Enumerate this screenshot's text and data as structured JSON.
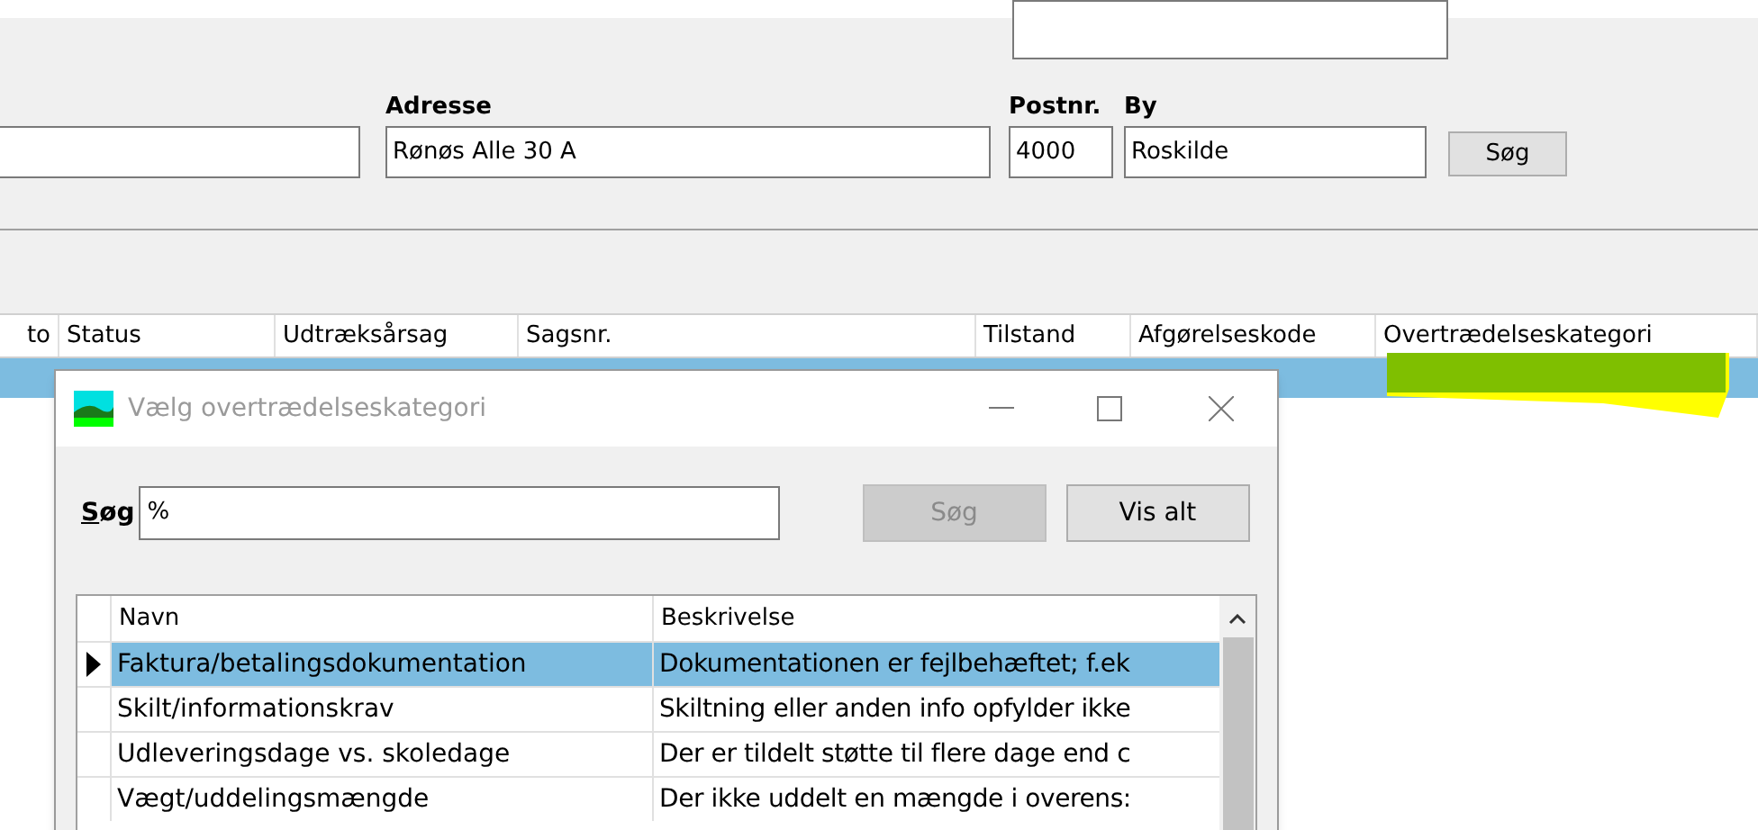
{
  "form": {
    "leading_field_shown": true,
    "fields": [
      {
        "label": "Adresse",
        "value": "Rønøs Alle 30 A"
      },
      {
        "label": "Postnr.",
        "value": "4000"
      },
      {
        "label": "By",
        "value": "Roskilde"
      }
    ],
    "search_button": "Søg"
  },
  "table": {
    "columns": [
      "to",
      "Status",
      "Udtræksårsag",
      "Sagsnr.",
      "Tilstand",
      "Afgørelseskode",
      "Overtrædelseskategori"
    ],
    "rows": [
      {
        "selected": true,
        "highlighted": true
      }
    ]
  },
  "dialog": {
    "title": "Vælg overtrædelseskategori",
    "search_label": "Søg",
    "search_value": "%",
    "buttons": [
      {
        "label": "Søg",
        "disabled": true
      },
      {
        "label": "Vis alt",
        "disabled": false
      }
    ],
    "columns": [
      "Navn",
      "Beskrivelse"
    ],
    "rows": [
      {
        "name": "Faktura/betalingsdokumentation",
        "description": "Dokumentationen er fejlbehæftet; f.ek",
        "selected": true
      },
      {
        "name": "Skilt/informationskrav",
        "description": "Skiltning eller anden info opfylder ikke",
        "selected": false
      },
      {
        "name": "Udleveringsdage vs. skoledage",
        "description": "Der er tildelt støtte til flere dage end c",
        "selected": false
      },
      {
        "name": "Vægt/uddelingsmængde",
        "description": "Der ikke uddelt en mængde i overens:",
        "selected": false
      }
    ]
  }
}
